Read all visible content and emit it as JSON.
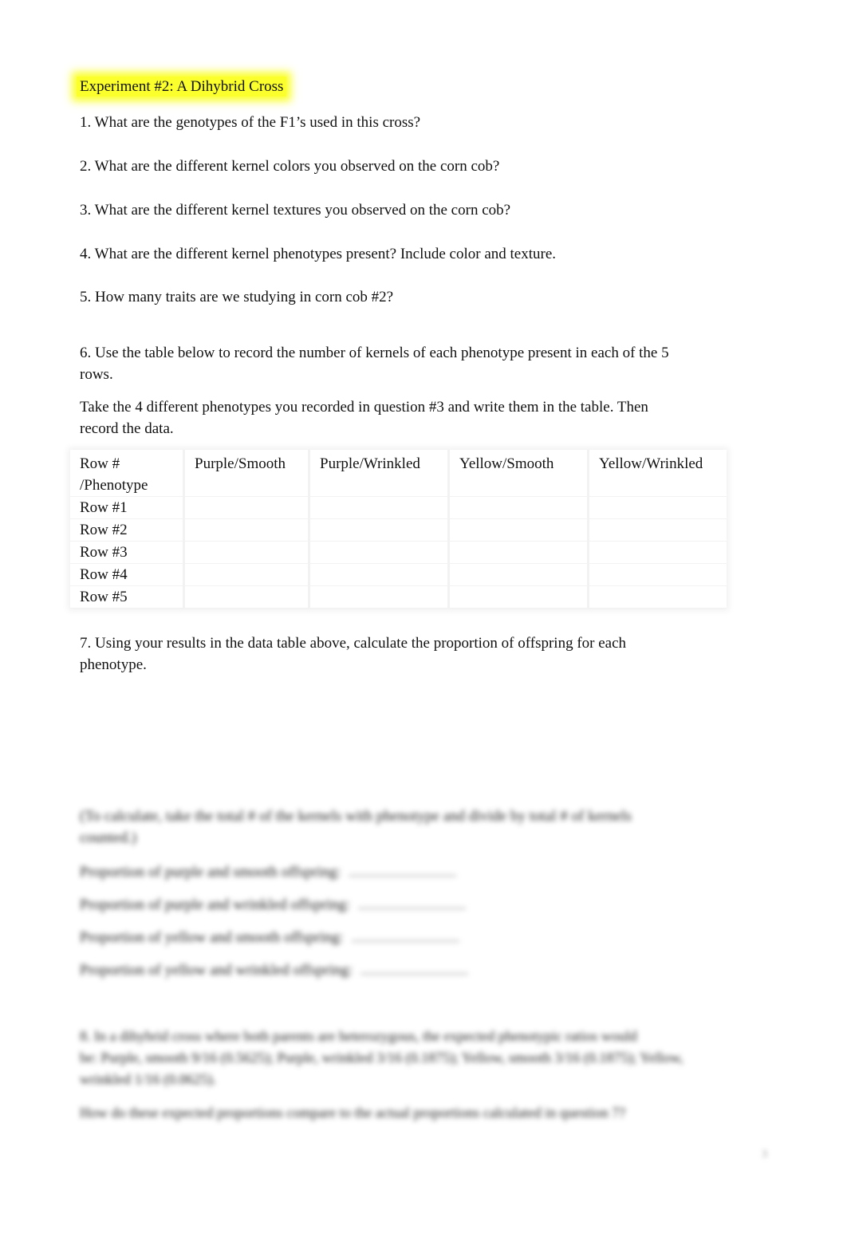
{
  "title": "Experiment #2: A Dihybrid Cross",
  "questions": {
    "q1": "1. What are the genotypes of the F1’s used in this cross?",
    "q2": "2. What are the different kernel colors you observed on the corn cob?",
    "q3": "3. What are the different kernel textures you observed on the corn cob?",
    "q4": "4. What are the different kernel phenotypes present? Include color and texture.",
    "q5": "5. How many traits are we studying in corn cob #2?",
    "q6_line1": "6. Use the table below to record the number of kernels of each phenotype present in each of the 5",
    "q6_line2": "rows.",
    "q6_instr_line1": "Take the 4 different phenotypes you recorded in question #3 and write them in the table. Then",
    "q6_instr_line2": "record the data.",
    "q7_line1": "7. Using your results in the data table above, calculate the proportion of offspring for each",
    "q7_line2": "phenotype."
  },
  "table": {
    "headers": [
      "Row #",
      "Purple/Smooth",
      "Purple/Wrinkled",
      "Yellow/Smooth",
      "Yellow/Wrinkled"
    ],
    "header_second_line": "/Phenotype",
    "rows": [
      {
        "label": "Row #1",
        "values": [
          "",
          "",
          "",
          ""
        ]
      },
      {
        "label": "Row #2",
        "values": [
          "",
          "",
          "",
          ""
        ]
      },
      {
        "label": "Row #3",
        "values": [
          "",
          "",
          "",
          ""
        ]
      },
      {
        "label": "Row #4",
        "values": [
          "",
          "",
          "",
          ""
        ]
      },
      {
        "label": "Row #5",
        "values": [
          "",
          "",
          "",
          ""
        ]
      }
    ]
  },
  "blurred": {
    "hint_line1": "(To calculate, take the total # of the kernels with phenotype and divide by total # of kernels",
    "hint_line2": "counted.)",
    "prop1": "Proportion of purple and smooth offspring:",
    "prop2": "Proportion of purple and wrinkled offspring:",
    "prop3": "Proportion of yellow and smooth offspring:",
    "prop4": "Proportion of yellow and wrinkled offspring:",
    "q8_line1": "8. In a dihybrid cross where both parents are heterozygous, the expected phenotypic ratios would",
    "q8_line2": "be: Purple, smooth 9/16 (0.5625); Purple, wrinkled 3/16 (0.1875); Yellow, smooth 3/16 (0.1875); Yellow,",
    "q8_line3": "wrinkled 1/16 (0.0625).",
    "q8_question": "How do these expected proportions compare to the actual proportions calculated in question 7?",
    "page_number": "3"
  }
}
